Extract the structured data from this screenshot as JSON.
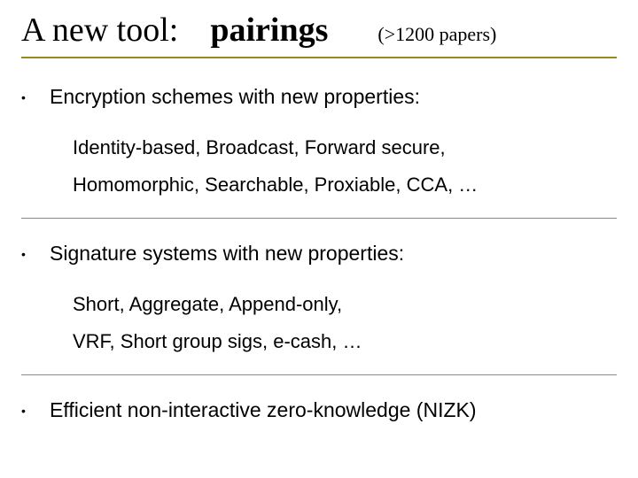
{
  "title": {
    "left": "A new tool:",
    "mid": "pairings",
    "right": "(>1200 papers)"
  },
  "bullets": [
    {
      "main": "Encryption schemes with new properties:",
      "sub": [
        "Identity-based,  Broadcast,   Forward secure,",
        "Homomorphic,   Searchable,   Proxiable,   CCA,  …"
      ]
    },
    {
      "main": "Signature systems with new properties:",
      "sub": [
        "Short,      Aggregate,     Append-only,",
        "VRF,   Short group sigs,   e-cash,   …"
      ]
    },
    {
      "main": "Efficient non-interactive zero-knowledge  (NIZK)",
      "sub": []
    }
  ]
}
